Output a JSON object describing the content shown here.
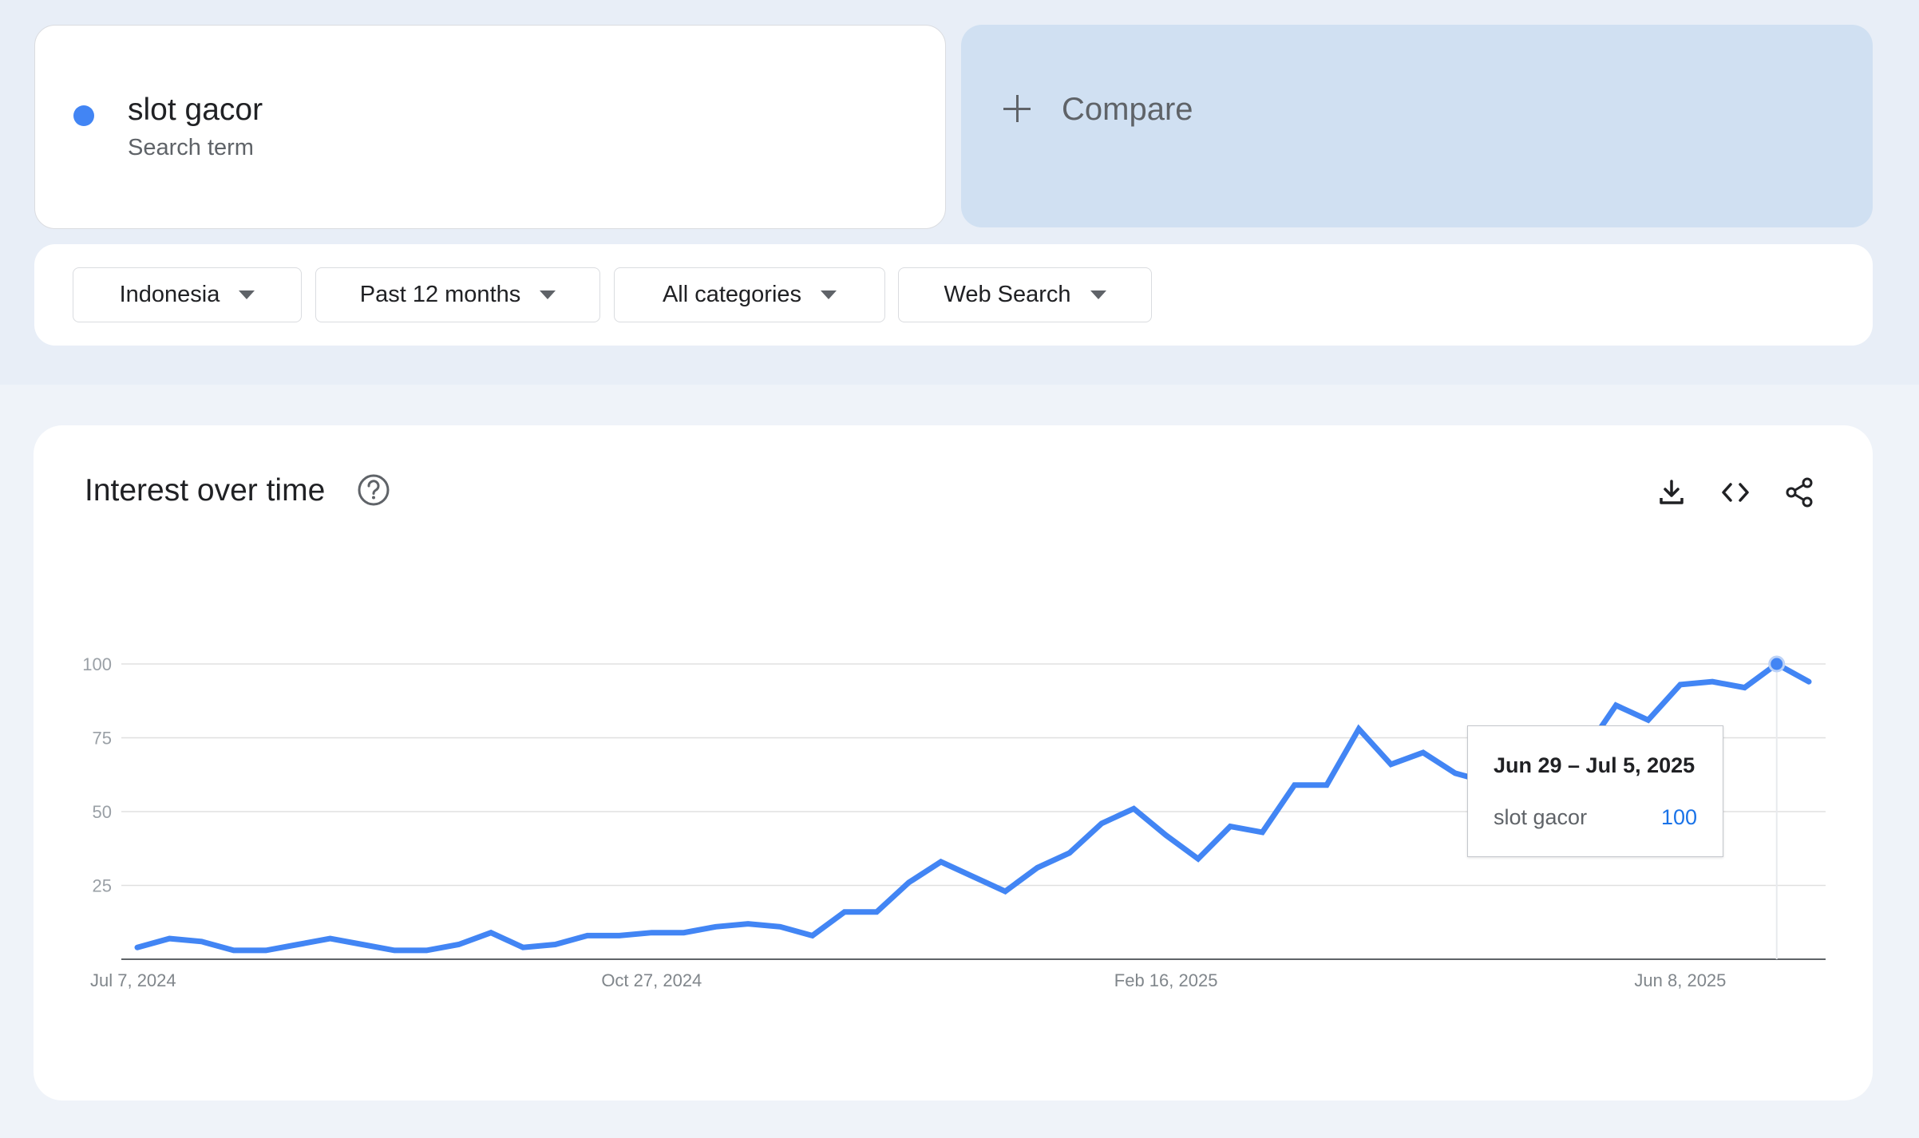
{
  "search_term": {
    "name": "slot gacor",
    "subtitle": "Search term",
    "color": "#4285f4"
  },
  "compare": {
    "label": "Compare",
    "icon": "plus-icon"
  },
  "filters": [
    {
      "label": "Indonesia"
    },
    {
      "label": "Past 12 months"
    },
    {
      "label": "All categories"
    },
    {
      "label": "Web Search"
    }
  ],
  "panel": {
    "title": "Interest over time",
    "icons": [
      "help-icon",
      "download-icon",
      "embed-code-icon",
      "share-icon"
    ]
  },
  "tooltip": {
    "date": "Jun 29 – Jul 5, 2025",
    "term": "slot gacor",
    "value": "100"
  },
  "chart_data": {
    "type": "line",
    "title": "Interest over time",
    "x_tick_labels": [
      "Jul 7, 2024",
      "Oct 27, 2024",
      "Feb 16, 2025",
      "Jun 8, 2025"
    ],
    "y_ticks": [
      25,
      50,
      75,
      100
    ],
    "ylim": [
      0,
      100
    ],
    "grid": true,
    "line_color": "#4285f4",
    "series": [
      {
        "name": "slot gacor",
        "x": [
          "2024-07-07",
          "2024-07-14",
          "2024-07-21",
          "2024-07-28",
          "2024-08-04",
          "2024-08-11",
          "2024-08-18",
          "2024-08-25",
          "2024-09-01",
          "2024-09-08",
          "2024-09-15",
          "2024-09-22",
          "2024-09-29",
          "2024-10-06",
          "2024-10-13",
          "2024-10-20",
          "2024-10-27",
          "2024-11-03",
          "2024-11-10",
          "2024-11-17",
          "2024-11-24",
          "2024-12-01",
          "2024-12-08",
          "2024-12-15",
          "2024-12-22",
          "2024-12-29",
          "2025-01-05",
          "2025-01-12",
          "2025-01-19",
          "2025-01-26",
          "2025-02-02",
          "2025-02-09",
          "2025-02-16",
          "2025-02-23",
          "2025-03-02",
          "2025-03-09",
          "2025-03-16",
          "2025-03-23",
          "2025-03-30",
          "2025-04-06",
          "2025-04-13",
          "2025-04-20",
          "2025-04-27",
          "2025-05-04",
          "2025-05-11",
          "2025-05-18",
          "2025-05-25",
          "2025-06-01",
          "2025-06-08",
          "2025-06-15",
          "2025-06-22",
          "2025-06-29",
          "2025-07-06"
        ],
        "values": [
          4,
          7,
          6,
          3,
          3,
          5,
          7,
          5,
          3,
          3,
          5,
          9,
          4,
          5,
          8,
          8,
          9,
          9,
          11,
          12,
          11,
          8,
          16,
          16,
          26,
          33,
          28,
          23,
          31,
          36,
          46,
          51,
          42,
          34,
          45,
          43,
          59,
          59,
          78,
          66,
          70,
          63,
          60,
          43,
          58,
          70,
          86,
          81,
          93,
          94,
          92,
          100,
          94
        ]
      }
    ],
    "highlight": {
      "x": "2025-06-29",
      "value": 100
    }
  }
}
